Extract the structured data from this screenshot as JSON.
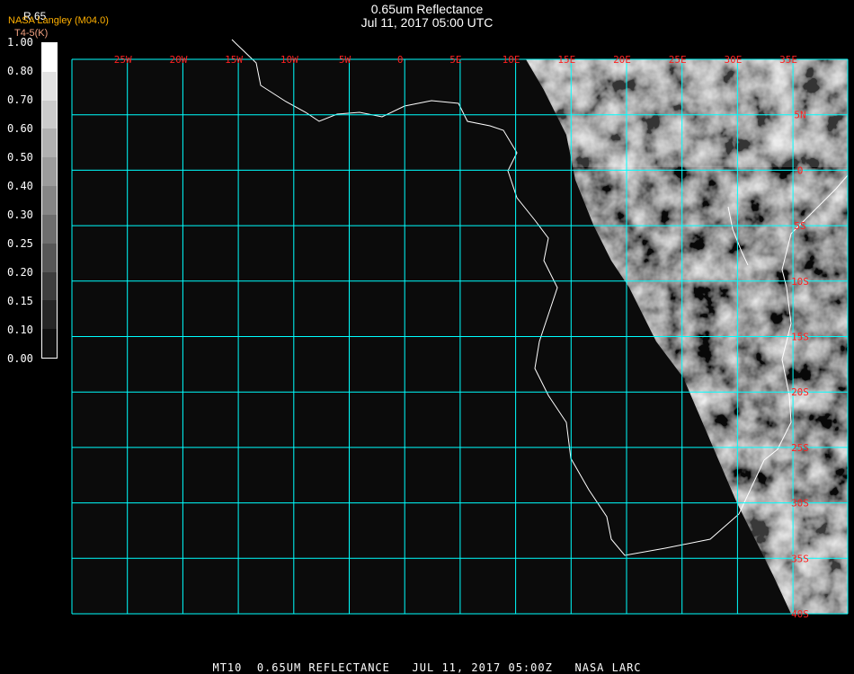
{
  "header": {
    "title": "0.65um Reflectance",
    "subtitle": "Jul 11, 2017 05:00 UTC"
  },
  "legend": {
    "variable": "R.65",
    "organization": "NASA Langley (M04.0)",
    "unit_label": "T4-5(K)",
    "ticks": [
      "1.00",
      "0.80",
      "0.70",
      "0.60",
      "0.50",
      "0.40",
      "0.30",
      "0.25",
      "0.20",
      "0.15",
      "0.10",
      "0.00"
    ],
    "colors": [
      "#ffffff",
      "#e2e2e2",
      "#cbcbcb",
      "#b1b1b1",
      "#9c9c9c",
      "#868686",
      "#6e6e6e",
      "#575757",
      "#3e3e3e",
      "#262626",
      "#101010"
    ]
  },
  "map": {
    "grid_color": "#00ffff",
    "ocean_color": "#0b0b0b",
    "coast_color": "#ffffff",
    "label_color": "#ff2020",
    "lon_labels": [
      "25W",
      "20W",
      "15W",
      "10W",
      "5W",
      "0",
      "5E",
      "10E",
      "15E",
      "20E",
      "25E",
      "30E",
      "35E"
    ],
    "lat_labels": [
      "5N",
      "0",
      "5S",
      "10S",
      "15S",
      "20S",
      "25S",
      "30S",
      "35S",
      "40S"
    ]
  },
  "footer": {
    "text": "MT10  0.65UM REFLECTANCE   JUL 11, 2017 05:00Z   NASA LARC"
  }
}
